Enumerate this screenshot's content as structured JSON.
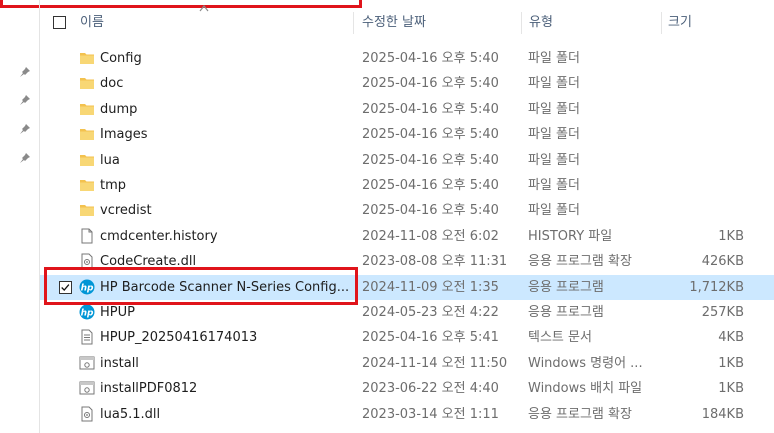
{
  "columns": {
    "name": "이름",
    "date": "수정한 날짜",
    "type": "유형",
    "size": "크기"
  },
  "files": [
    {
      "name": "Config",
      "date": "2025-04-16 오후 5:40",
      "type": "파일 폴더",
      "size": "",
      "icon": "folder-icon"
    },
    {
      "name": "doc",
      "date": "2025-04-16 오후 5:40",
      "type": "파일 폴더",
      "size": "",
      "icon": "folder-icon"
    },
    {
      "name": "dump",
      "date": "2025-04-16 오후 5:40",
      "type": "파일 폴더",
      "size": "",
      "icon": "folder-icon"
    },
    {
      "name": "Images",
      "date": "2025-04-16 오후 5:40",
      "type": "파일 폴더",
      "size": "",
      "icon": "folder-icon"
    },
    {
      "name": "lua",
      "date": "2025-04-16 오후 5:40",
      "type": "파일 폴더",
      "size": "",
      "icon": "folder-icon"
    },
    {
      "name": "tmp",
      "date": "2025-04-16 오후 5:40",
      "type": "파일 폴더",
      "size": "",
      "icon": "folder-icon"
    },
    {
      "name": "vcredist",
      "date": "2025-04-16 오후 5:40",
      "type": "파일 폴더",
      "size": "",
      "icon": "folder-icon"
    },
    {
      "name": "cmdcenter.history",
      "date": "2024-11-08 오전 6:02",
      "type": "HISTORY 파일",
      "size": "1KB",
      "icon": "file-icon"
    },
    {
      "name": "CodeCreate.dll",
      "date": "2023-08-08 오후 11:31",
      "type": "응용 프로그램 확장",
      "size": "426KB",
      "icon": "dll-icon"
    },
    {
      "name": "HP Barcode Scanner N-Series Config...",
      "date": "2024-11-09 오전 1:35",
      "type": "응용 프로그램",
      "size": "1,712KB",
      "icon": "hp-logo-icon",
      "selected": true
    },
    {
      "name": "HPUP",
      "date": "2024-05-23 오전 4:22",
      "type": "응용 프로그램",
      "size": "257KB",
      "icon": "hp-logo-icon"
    },
    {
      "name": "HPUP_20250416174013",
      "date": "2025-04-16 오후 5:41",
      "type": "텍스트 문서",
      "size": "4KB",
      "icon": "text-document-icon"
    },
    {
      "name": "install",
      "date": "2024-11-14 오전 11:50",
      "type": "Windows 명령어 ...",
      "size": "1KB",
      "icon": "batch-file-icon"
    },
    {
      "name": "installPDF0812",
      "date": "2023-06-22 오전 4:40",
      "type": "Windows 배치 파일",
      "size": "1KB",
      "icon": "batch-file-icon"
    },
    {
      "name": "lua5.1.dll",
      "date": "2023-03-14 오전 1:11",
      "type": "응용 프로그램 확장",
      "size": "184KB",
      "icon": "dll-icon"
    }
  ],
  "colors": {
    "selection": "#cce8ff",
    "highlight": "#e0141b",
    "folder": "#f3c24f",
    "hp": "#0096d6"
  }
}
